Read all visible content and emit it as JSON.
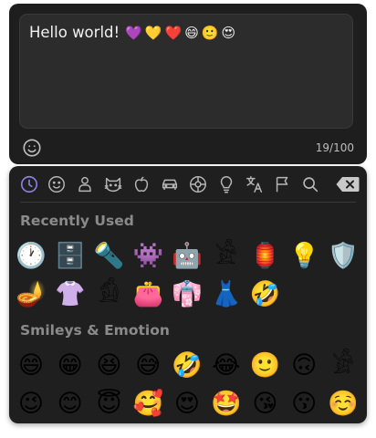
{
  "composer": {
    "text": "Hello world!",
    "text_emojis": [
      "💜",
      "💛",
      "❤️",
      "😄",
      "🙂",
      "😍"
    ],
    "char_count": "19/100",
    "emoji_button_icon": "smiley-icon"
  },
  "picker": {
    "tabs": [
      {
        "name": "recent",
        "icon": "clock-icon",
        "active": true
      },
      {
        "name": "smileys",
        "icon": "smiley-icon",
        "active": false
      },
      {
        "name": "people",
        "icon": "person-icon",
        "active": false
      },
      {
        "name": "animals",
        "icon": "cat-icon",
        "active": false
      },
      {
        "name": "food",
        "icon": "apple-icon",
        "active": false
      },
      {
        "name": "travel",
        "icon": "car-icon",
        "active": false
      },
      {
        "name": "activities",
        "icon": "ball-icon",
        "active": false
      },
      {
        "name": "objects",
        "icon": "lightbulb-icon",
        "active": false
      },
      {
        "name": "symbols",
        "icon": "translate-icon",
        "active": false
      },
      {
        "name": "flags",
        "icon": "flag-icon",
        "active": false
      },
      {
        "name": "search",
        "icon": "search-icon",
        "active": false
      }
    ],
    "backspace_icon": "backspace-icon",
    "accent_color": "#8a7fe0",
    "sections": [
      {
        "title": "Recently Used",
        "emojis": [
          "🕐",
          "🗄️",
          "🔦",
          "👾",
          "🤖",
          "𓀀",
          "🏮",
          "💡",
          "🛡️",
          "🪔",
          "👚",
          "𓀁",
          "👛",
          "👘",
          "👗",
          "🤣"
        ]
      },
      {
        "title": "Smileys & Emotion",
        "emojis": [
          "😄",
          "😁",
          "😆",
          "😅",
          "🤣",
          "😂",
          "🙂",
          "🙃",
          "𓀂",
          "😉",
          "😊",
          "😇",
          "🥰",
          "😍",
          "🤩",
          "😘",
          "😗",
          "☺️"
        ]
      }
    ]
  }
}
